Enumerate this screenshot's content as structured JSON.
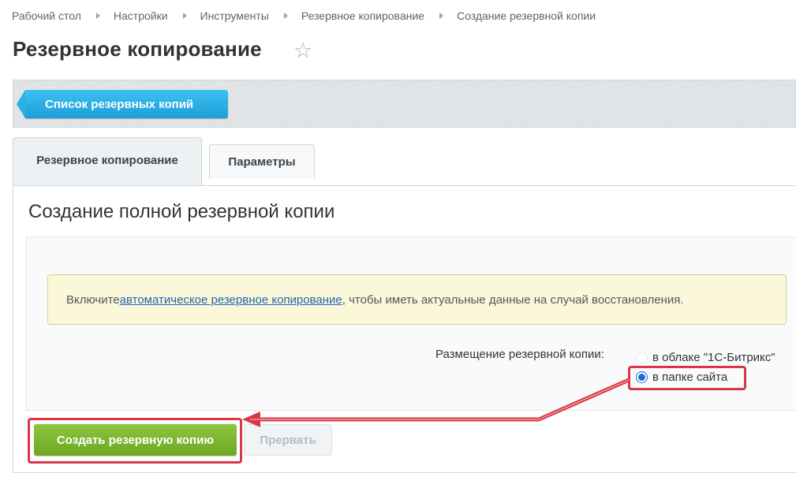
{
  "breadcrumb": [
    "Рабочий стол",
    "Настройки",
    "Инструменты",
    "Резервное копирование",
    "Создание резервной копии"
  ],
  "page_title": "Резервное копирование",
  "toolbar": {
    "list_button": "Список резервных копий"
  },
  "tabs": [
    "Резервное копирование",
    "Параметры"
  ],
  "panel": {
    "title": "Создание полной резервной копии",
    "notice": {
      "before": "Включите ",
      "link": "автоматическое резервное копирование",
      "after": ", чтобы иметь актуальные данные на случай восстановления."
    },
    "placement_label": "Размещение резервной копии:",
    "options": [
      "в облаке \"1С-Битрикс\"",
      "в папке сайта"
    ],
    "selected_option": "в папке сайта"
  },
  "actions": {
    "create": "Создать резервную копию",
    "abort": "Прервать"
  },
  "colors": {
    "accent": "#1d9ed9",
    "create": "#7ab52e",
    "highlight": "#d93745"
  }
}
